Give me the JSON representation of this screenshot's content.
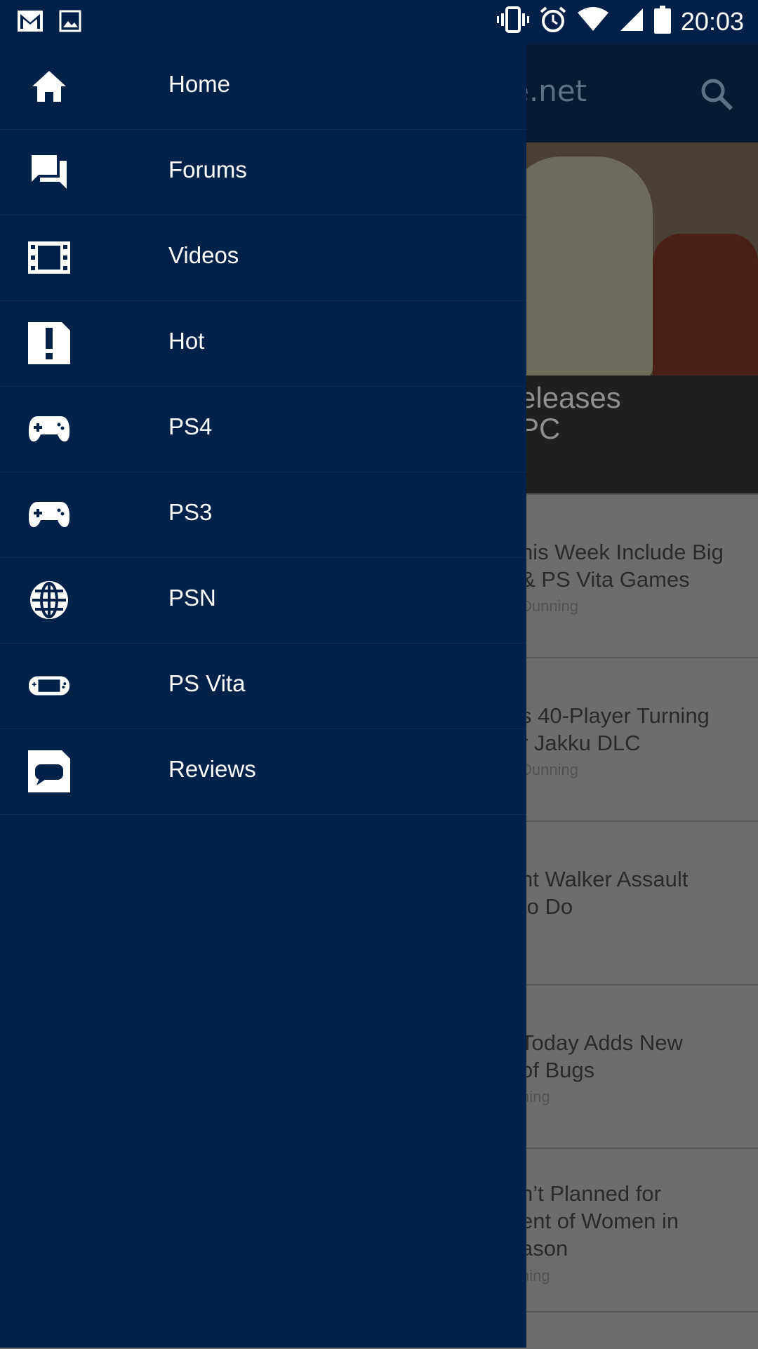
{
  "status_bar": {
    "time": "20:03",
    "icons": [
      "gmail-icon",
      "image-icon",
      "vibrate-icon",
      "alarm-icon",
      "wifi-icon",
      "signal-icon",
      "battery-icon"
    ]
  },
  "app": {
    "title_fragment": "e.net",
    "hero_caption_line1": "eleases",
    "hero_caption_line2": "PC",
    "articles": [
      {
        "line1": "his Week Include Big",
        "line2": "& PS Vita Games",
        "author": "Dunning"
      },
      {
        "line1": "s 40-Player Turning",
        "line2": "r Jakku DLC",
        "author": "Dunning"
      },
      {
        "line1": "nt Walker Assault",
        "line2": "to Do",
        "author": ""
      },
      {
        "line1": "Today Adds New",
        "line2": "of Bugs",
        "author": "ning"
      },
      {
        "line1": "n’t Planned for",
        "line2": "ent of Women in",
        "line3": "ason",
        "author": "ning"
      }
    ]
  },
  "drawer": {
    "items": [
      {
        "label": "Home",
        "icon": "home-icon"
      },
      {
        "label": "Forums",
        "icon": "forum-icon"
      },
      {
        "label": "Videos",
        "icon": "film-icon"
      },
      {
        "label": "Hot",
        "icon": "hot-icon"
      },
      {
        "label": "PS4",
        "icon": "gamepad-icon"
      },
      {
        "label": "PS3",
        "icon": "gamepad-icon"
      },
      {
        "label": "PSN",
        "icon": "globe-icon"
      },
      {
        "label": "PS Vita",
        "icon": "vita-icon"
      },
      {
        "label": "Reviews",
        "icon": "reviews-icon"
      }
    ]
  },
  "colors": {
    "drawer_bg": "#002248",
    "status_bar_bg": "#002047",
    "scrim_content": "#6d6d6d"
  }
}
